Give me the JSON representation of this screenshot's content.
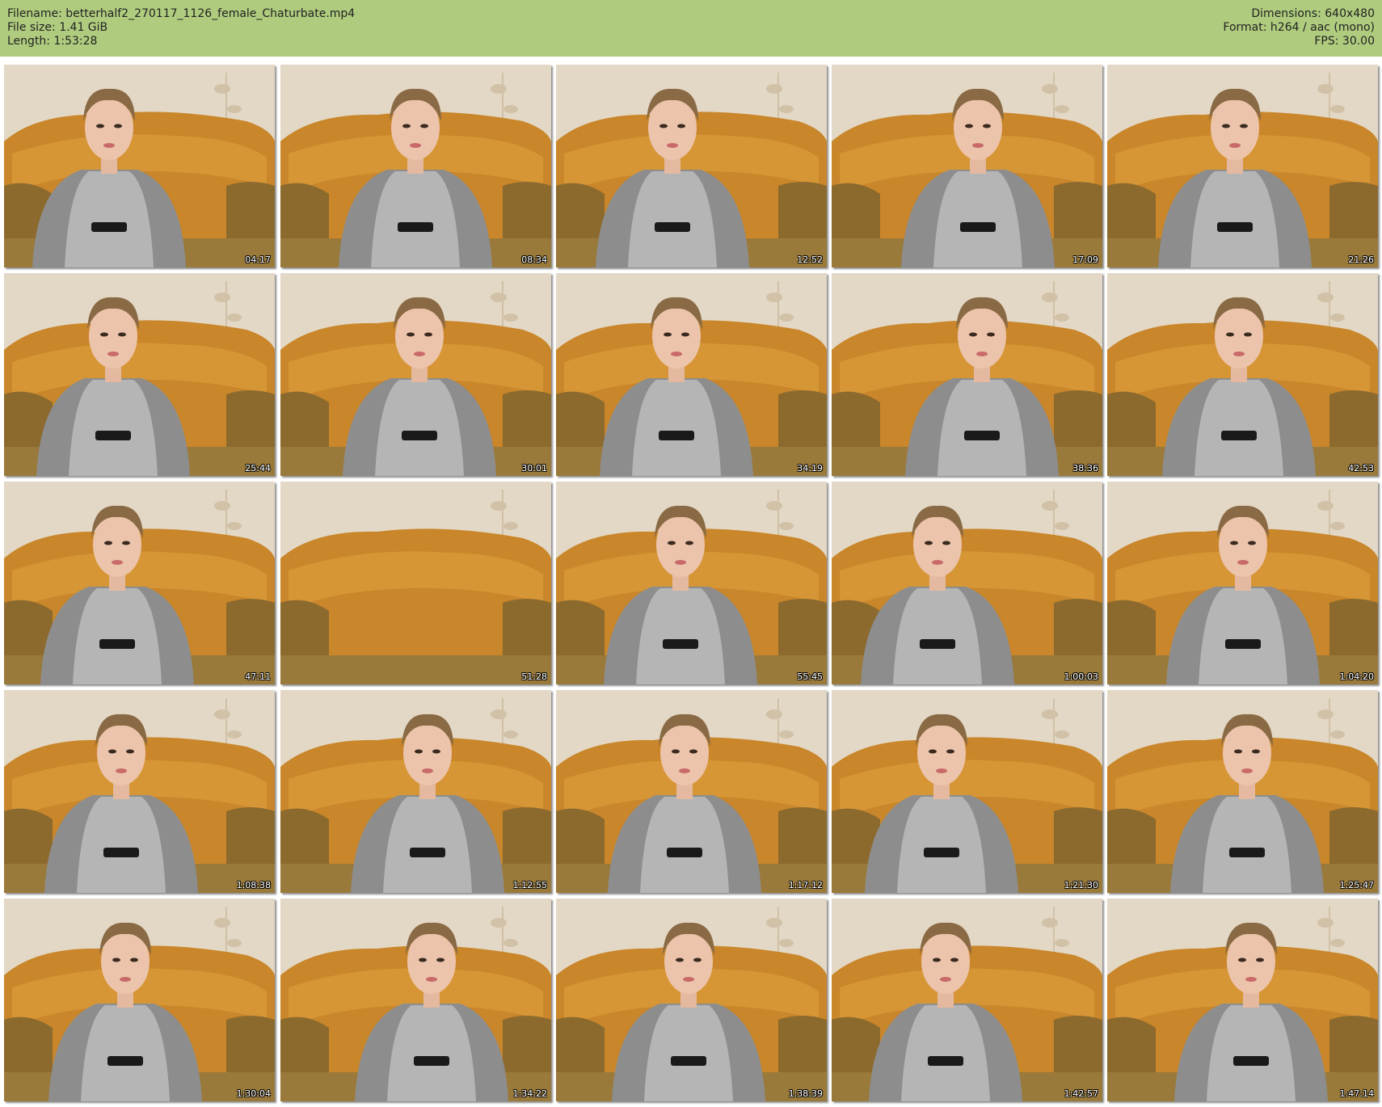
{
  "header": {
    "filename": "Filename: betterhalf2_270117_1126_female_Chaturbate.mp4",
    "filesize": "File size: 1.41 GiB",
    "length": "Length: 1:53:28",
    "dimensions": "Dimensions: 640x480",
    "format": "Format: h264 / aac (mono)",
    "fps": "FPS: 30.00",
    "background_color": "#afcc7e"
  },
  "thumbnails": [
    {
      "timestamp": "04:17",
      "subject": "person"
    },
    {
      "timestamp": "08:34",
      "subject": "person"
    },
    {
      "timestamp": "12:52",
      "subject": "person"
    },
    {
      "timestamp": "17:09",
      "subject": "person"
    },
    {
      "timestamp": "21:26",
      "subject": "person"
    },
    {
      "timestamp": "25:44",
      "subject": "person"
    },
    {
      "timestamp": "30:01",
      "subject": "person"
    },
    {
      "timestamp": "34:19",
      "subject": "person"
    },
    {
      "timestamp": "38:36",
      "subject": "person"
    },
    {
      "timestamp": "42:53",
      "subject": "person"
    },
    {
      "timestamp": "47:11",
      "subject": "person"
    },
    {
      "timestamp": "51:28",
      "subject": "empty-couch"
    },
    {
      "timestamp": "55:45",
      "subject": "person"
    },
    {
      "timestamp": "1:00:03",
      "subject": "person"
    },
    {
      "timestamp": "1:04:20",
      "subject": "person"
    },
    {
      "timestamp": "1:08:38",
      "subject": "person"
    },
    {
      "timestamp": "1:12:55",
      "subject": "person"
    },
    {
      "timestamp": "1:17:12",
      "subject": "person"
    },
    {
      "timestamp": "1:21:30",
      "subject": "person"
    },
    {
      "timestamp": "1:25:47",
      "subject": "person"
    },
    {
      "timestamp": "1:30:04",
      "subject": "person"
    },
    {
      "timestamp": "1:34:22",
      "subject": "person"
    },
    {
      "timestamp": "1:38:39",
      "subject": "person"
    },
    {
      "timestamp": "1:42:57",
      "subject": "person"
    },
    {
      "timestamp": "1:47:14",
      "subject": "person"
    }
  ]
}
